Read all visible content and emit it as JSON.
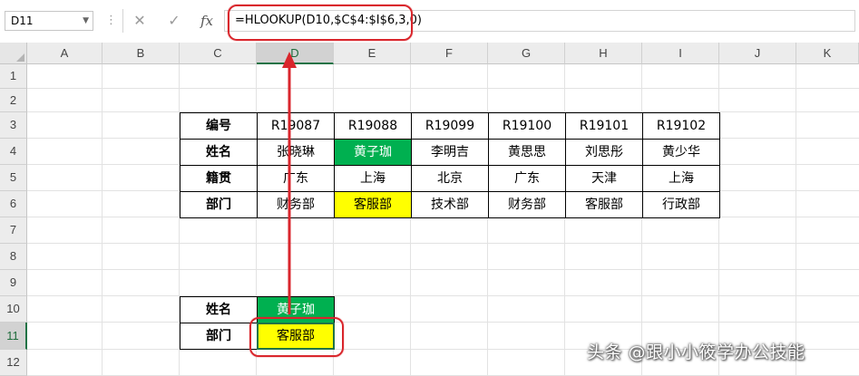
{
  "formula_bar": {
    "name_box": "D11",
    "cancel_icon": "✕",
    "enter_icon": "✓",
    "fx_label": "fx",
    "formula": "=HLOOKUP(D10,$C$4:$I$6,3,0)"
  },
  "sheet": {
    "columns": [
      "A",
      "B",
      "C",
      "D",
      "E",
      "F",
      "G",
      "H",
      "I",
      "J",
      "K"
    ],
    "rows": [
      "1",
      "2",
      "3",
      "4",
      "5",
      "6",
      "7",
      "8",
      "9",
      "10",
      "11",
      "12"
    ],
    "selected_column": "D",
    "selected_row": "11"
  },
  "table": {
    "headers": [
      "编号",
      "姓名",
      "籍贯",
      "部门"
    ],
    "ids": [
      "R19087",
      "R19088",
      "R19099",
      "R19100",
      "R19101",
      "R19102"
    ],
    "names": [
      "张晓琳",
      "黄子珈",
      "李明吉",
      "黄思思",
      "刘思彤",
      "黄少华"
    ],
    "origins": [
      "广东",
      "上海",
      "北京",
      "广东",
      "天津",
      "上海"
    ],
    "departments": [
      "财务部",
      "客服部",
      "技术部",
      "财务部",
      "客服部",
      "行政部"
    ]
  },
  "lookup": {
    "name_label": "姓名",
    "name_value": "黄子珈",
    "dept_label": "部门",
    "dept_value": "客服部"
  },
  "colors": {
    "green_fill": "#00b050",
    "yellow_fill": "#ffff00",
    "highlight_red": "#d9262c",
    "excel_green": "#217346"
  },
  "watermark": "头条 @跟小小筱学办公技能"
}
